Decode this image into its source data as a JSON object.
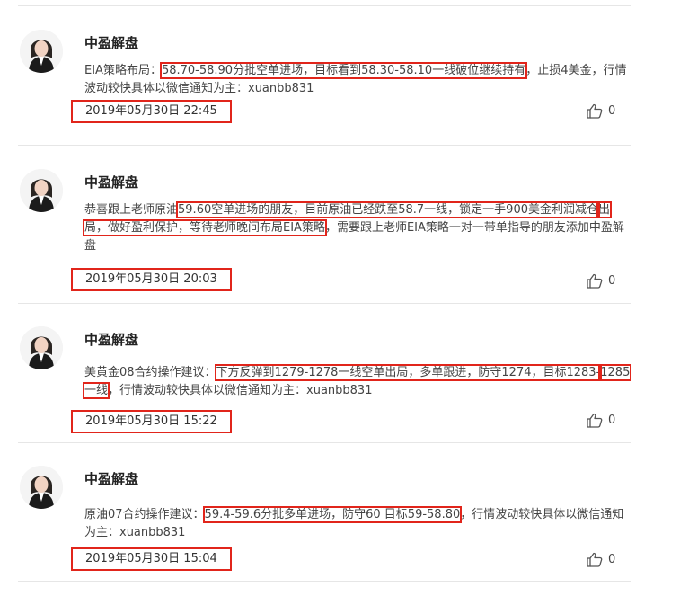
{
  "posts": [
    {
      "author": "中盈解盘",
      "segments": [
        {
          "text": "EIA策略布局：",
          "hl": false
        },
        {
          "text": "58.70-58.90分批空单进场，目标看到58.30-58.10一线破位继续持有",
          "hl": true
        },
        {
          "text": "，止损4美金，行情波动较快具体以微信通知为主：xuanbb831",
          "hl": false
        }
      ],
      "datetime": "2019年05月30日 22:45",
      "likes": "0"
    },
    {
      "author": "中盈解盘",
      "segments": [
        {
          "text": "恭喜跟上老师原油",
          "hl": false
        },
        {
          "text": "59.60空单进场的朋友，目前原油已经跌至58.7一线，锁定一手900美金利润减仓",
          "hl": true
        },
        {
          "text": "出局，做好盈利保护，等待老师晚间布局EIA策略",
          "hl": true
        },
        {
          "text": "，需要跟上老师EIA策略一对一带单指导的朋友添加中盈解盘",
          "hl": false
        }
      ],
      "datetime": "2019年05月30日 20:03",
      "likes": "0"
    },
    {
      "author": "中盈解盘",
      "segments": [
        {
          "text": "美黄金08合约操作建议：",
          "hl": false
        },
        {
          "text": "下方反弹到1279-1278一线空单出局，多单跟进，防守1274，目标1283-",
          "hl": true
        },
        {
          "text": "1285一线",
          "hl": true
        },
        {
          "text": "，行情波动较快具体以微信通知为主：xuanbb831",
          "hl": false
        }
      ],
      "datetime": "2019年05月30日 15:22",
      "likes": "0"
    },
    {
      "author": "中盈解盘",
      "segments": [
        {
          "text": "原油07合约操作建议：",
          "hl": false
        },
        {
          "text": "59.4-59.6分批多单进场，防守60 目标59-58.80",
          "hl": true
        },
        {
          "text": "，行情波动较快具体以微信通知为主：xuanbb831",
          "hl": false
        }
      ],
      "datetime": "2019年05月30日 15:04",
      "likes": "0"
    }
  ]
}
